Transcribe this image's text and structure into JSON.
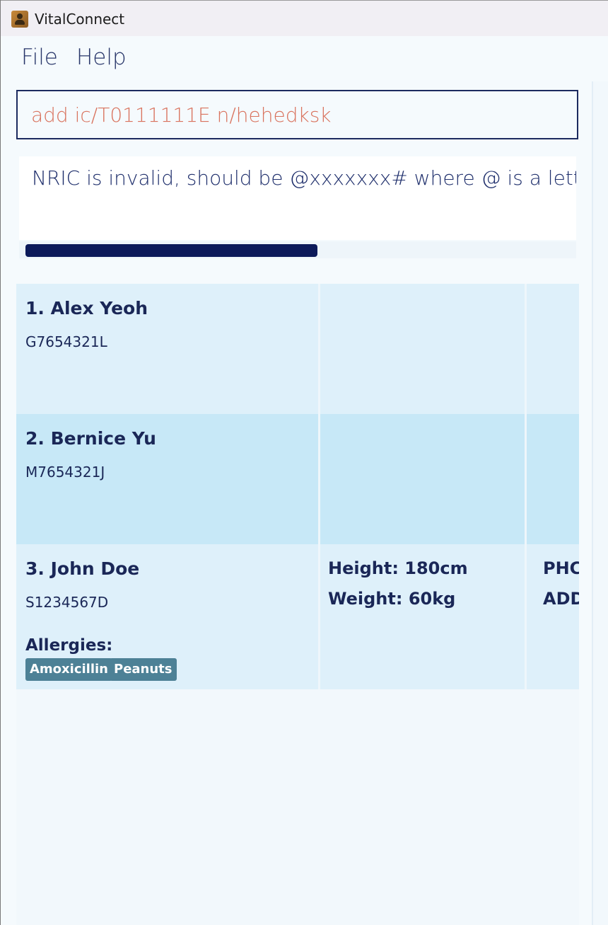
{
  "window": {
    "title": "VitalConnect",
    "app_icon": "address-book-icon"
  },
  "menu": {
    "file_label": "File",
    "help_label": "Help"
  },
  "command": {
    "value": "add ic/T0111111E n/hehedksk"
  },
  "result": {
    "message": "NRIC is invalid, should be @xxxxxxx# where @ is a letter that"
  },
  "colors": {
    "accent": "#0c1a5a",
    "tag_bg": "#4d8196",
    "error_text": "#d9735e",
    "row_light": "#def0fa",
    "row_dark": "#c7e8f7"
  },
  "patients": [
    {
      "name": "1. Alex Yeoh",
      "nric": "G7654321L"
    },
    {
      "name": "2. Bernice Yu",
      "nric": "M7654321J"
    },
    {
      "name": "3. John Doe",
      "nric": "S1234567D",
      "allergies_label": "Allergies:",
      "allergies": [
        "Amoxicillin",
        "Peanuts"
      ],
      "height": "Height: 180cm",
      "weight": "Weight: 60kg",
      "phone_partial": "PHC",
      "address_partial": "ADD"
    }
  ]
}
